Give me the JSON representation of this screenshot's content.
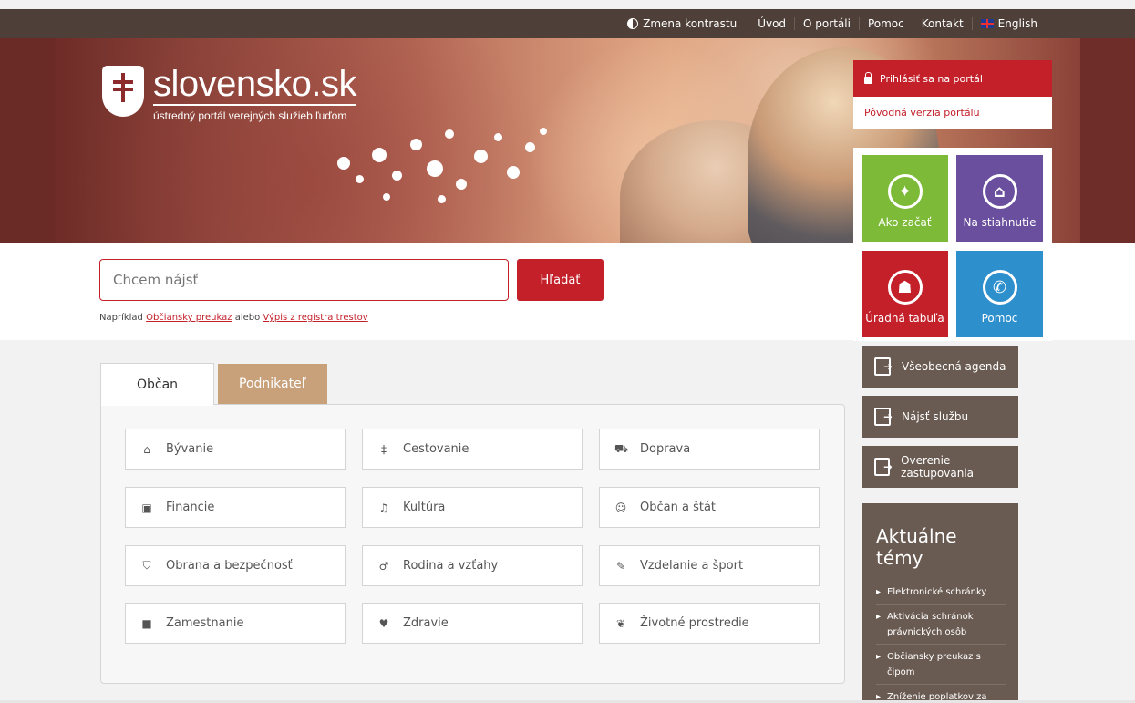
{
  "topnav": {
    "contrast": "Zmena kontrastu",
    "links": [
      "Úvod",
      "O portáli",
      "Pomoc",
      "Kontakt"
    ],
    "language": "English"
  },
  "logo": {
    "title": "slovensko.sk",
    "subtitle": "ústredný portál verejných služieb ľuďom"
  },
  "login": {
    "button": "Prihlásiť sa na portál",
    "old_version": "Pôvodná verzia portálu"
  },
  "search": {
    "placeholder": "Chcem nájsť",
    "button": "Hľadať",
    "hint_prefix": "Napríklad",
    "hint_link1": "Občiansky preukaz",
    "hint_middle": "alebo",
    "hint_link2": "Výpis z registra trestov"
  },
  "tiles": [
    {
      "label": "Ako začať",
      "icon": "lightbulb-icon",
      "color": "#7dba37"
    },
    {
      "label": "Na stiahnutie",
      "icon": "download-house-icon",
      "color": "#6a4f9e"
    },
    {
      "label": "Úradná tabuľa",
      "icon": "notice-board-icon",
      "color": "#c3202a"
    },
    {
      "label": "Pomoc",
      "icon": "phone-icon",
      "color": "#2e8fcd"
    }
  ],
  "side_buttons": [
    "Všeobecná agenda",
    "Nájsť službu",
    "Overenie zastupovania"
  ],
  "topics": {
    "title": "Aktuálne témy",
    "items": [
      "Elektronické schránky",
      "Aktivácia schránok právnických osôb",
      "Občiansky preukaz s čipom",
      "Zníženie poplatkov za elektronické podania"
    ]
  },
  "tabs": {
    "active": "Občan",
    "other": "Podnikateľ"
  },
  "categories": [
    {
      "label": "Bývanie",
      "icon": "house-icon",
      "glyph": "⌂"
    },
    {
      "label": "Cestovanie",
      "icon": "signpost-icon",
      "glyph": "‡"
    },
    {
      "label": "Doprava",
      "icon": "car-icon",
      "glyph": "⛟"
    },
    {
      "label": "Financie",
      "icon": "money-icon",
      "glyph": "▣"
    },
    {
      "label": "Kultúra",
      "icon": "music-icon",
      "glyph": "♫"
    },
    {
      "label": "Občan a štát",
      "icon": "group-icon",
      "glyph": "☺"
    },
    {
      "label": "Obrana a bezpečnosť",
      "icon": "shield-icon",
      "glyph": "⛉"
    },
    {
      "label": "Rodina a vzťahy",
      "icon": "family-icon",
      "glyph": "♂"
    },
    {
      "label": "Vzdelanie a šport",
      "icon": "graduation-cap-icon",
      "glyph": "✎"
    },
    {
      "label": "Zamestnanie",
      "icon": "briefcase-icon",
      "glyph": "■"
    },
    {
      "label": "Zdravie",
      "icon": "heartbeat-icon",
      "glyph": "♥"
    },
    {
      "label": "Životné prostredie",
      "icon": "leaf-icon",
      "glyph": "❦"
    }
  ]
}
